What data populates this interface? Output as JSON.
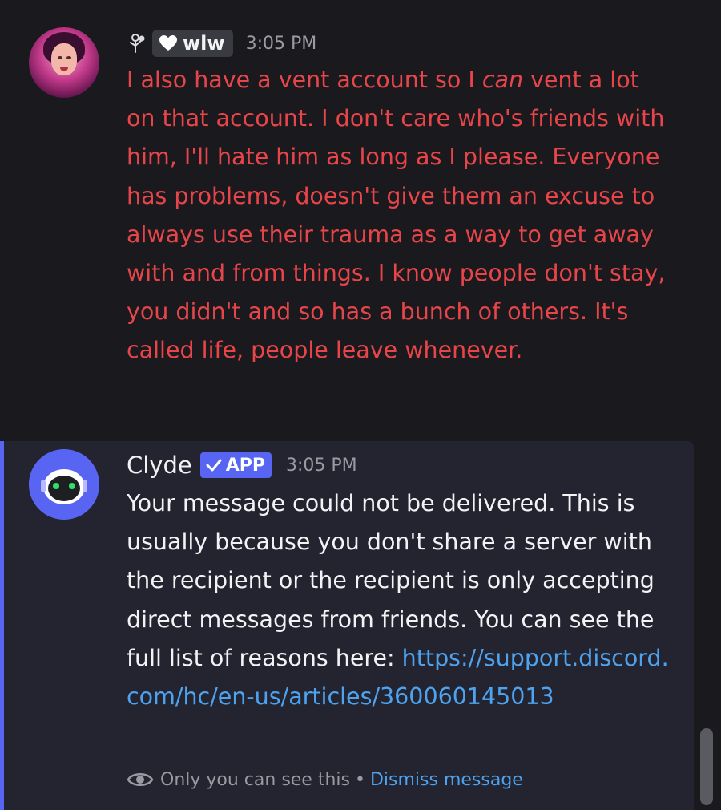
{
  "messages": {
    "first": {
      "author_badge": "wlw",
      "time": "3:05 PM",
      "text_before_italic": "I also have a vent account so I ",
      "text_italic": "can",
      "text_after_italic": " vent a lot on that account. I don't care who's friends with him, I'll hate him as long as I please. Everyone has problems, doesn't give them an excuse to always use their trauma as a way to get away with and from things. I know people don't stay, you didn't and so has a bunch of others. It's called life, people leave whenever.",
      "text_color": "#e8454a",
      "role_icon": "flower-person-icon",
      "badge_icon": "heart-icon"
    },
    "second": {
      "author": "Clyde",
      "app_tag": "APP",
      "time": "3:05 PM",
      "text": "Your message could not be delivered. This is usually because you don't share a server with the recipient or the recipient is only accepting direct messages from friends. You can see the full list of reasons here: ",
      "link": "https://support.discord.com/hc/en-us/articles/360060145013",
      "ephemeral_note": "Only you can see this",
      "separator": "•",
      "dismiss_label": "Dismiss message",
      "accent_color": "#5865f2",
      "link_color": "#4ea3f0"
    }
  }
}
